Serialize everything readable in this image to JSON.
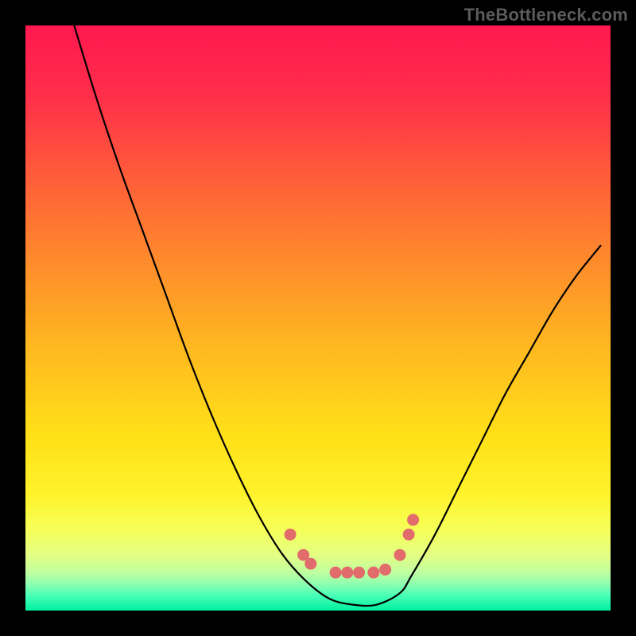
{
  "watermark": "TheBottleneck.com",
  "gradient": {
    "stops": [
      {
        "offset": 0.0,
        "color": "#ff1850"
      },
      {
        "offset": 0.12,
        "color": "#ff2e4a"
      },
      {
        "offset": 0.25,
        "color": "#ff5a3a"
      },
      {
        "offset": 0.4,
        "color": "#ff8a2c"
      },
      {
        "offset": 0.55,
        "color": "#ffb820"
      },
      {
        "offset": 0.7,
        "color": "#ffe018"
      },
      {
        "offset": 0.8,
        "color": "#fff22a"
      },
      {
        "offset": 0.86,
        "color": "#f6ff56"
      },
      {
        "offset": 0.905,
        "color": "#e4ff84"
      },
      {
        "offset": 0.935,
        "color": "#c0ffa0"
      },
      {
        "offset": 0.955,
        "color": "#8cffb0"
      },
      {
        "offset": 0.975,
        "color": "#46ffb6"
      },
      {
        "offset": 1.0,
        "color": "#00f0a0"
      }
    ]
  },
  "curve": {
    "stroke": "#000000",
    "stroke_width": 2.2,
    "marker_color": "#e26b6b",
    "marker_radius": 7.5
  },
  "curve_markers": [
    {
      "x": 0.4525,
      "y": 0.87
    },
    {
      "x": 0.475,
      "y": 0.905
    },
    {
      "x": 0.4875,
      "y": 0.92
    },
    {
      "x": 0.53,
      "y": 0.935
    },
    {
      "x": 0.55,
      "y": 0.935
    },
    {
      "x": 0.57,
      "y": 0.935
    },
    {
      "x": 0.595,
      "y": 0.935
    },
    {
      "x": 0.615,
      "y": 0.93
    },
    {
      "x": 0.64,
      "y": 0.905
    },
    {
      "x": 0.655,
      "y": 0.87
    },
    {
      "x": 0.6625,
      "y": 0.845
    }
  ],
  "chart_data": {
    "type": "line",
    "title": "",
    "xlabel": "",
    "ylabel": "",
    "xlim": [
      0,
      1
    ],
    "ylim": [
      0,
      1
    ],
    "series": [
      {
        "name": "bottleneck-curve",
        "x": [
          0.08,
          0.12,
          0.16,
          0.2,
          0.24,
          0.28,
          0.32,
          0.36,
          0.4,
          0.44,
          0.48,
          0.52,
          0.56,
          0.6,
          0.64,
          0.66,
          0.7,
          0.74,
          0.78,
          0.82,
          0.86,
          0.9,
          0.94,
          0.98
        ],
        "y": [
          1.0,
          0.88,
          0.76,
          0.65,
          0.54,
          0.43,
          0.33,
          0.24,
          0.16,
          0.095,
          0.05,
          0.02,
          0.01,
          0.01,
          0.03,
          0.06,
          0.13,
          0.21,
          0.29,
          0.37,
          0.44,
          0.51,
          0.57,
          0.62
        ]
      }
    ],
    "annotations": [
      {
        "text": "TheBottleneck.com",
        "pos": "top-right"
      }
    ],
    "note": "y is normalized bottleneck percentage (0 at valley, 1 at top of plot). x is normalized horizontal position. Curve has wide flat minimum around x≈0.52–0.62; salmon markers cluster near the minimum."
  }
}
